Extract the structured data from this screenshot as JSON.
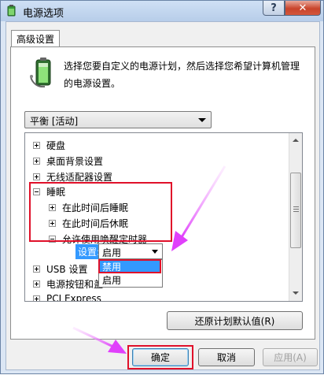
{
  "window": {
    "title": "电源选项",
    "help_label": "?",
    "close_label": "✕"
  },
  "tab": {
    "label": "高级设置"
  },
  "description": "选择您要自定义的电源计划，然后选择您希望计算机管理的电源设置。",
  "plan_select": {
    "value": "平衡 [活动]"
  },
  "tree": {
    "items": [
      {
        "label": "硬盘",
        "expanded": false
      },
      {
        "label": "桌面背景设置",
        "expanded": false
      },
      {
        "label": "无线适配器设置",
        "expanded": false
      },
      {
        "label": "睡眠",
        "expanded": true
      },
      {
        "label": "在此时间后睡眠",
        "expanded": false
      },
      {
        "label": "在此时间后休眠",
        "expanded": false
      },
      {
        "label": "允许使用唤醒定时器",
        "expanded": true
      },
      {
        "label": "USB 设置",
        "expanded": false
      },
      {
        "label": "电源按钮和盖",
        "expanded": false
      },
      {
        "label": "PCI Express",
        "expanded": false
      }
    ]
  },
  "setting": {
    "label": "设置:",
    "value": "启用",
    "options": [
      "禁用",
      "启用"
    ]
  },
  "buttons": {
    "restore": "还原计划默认值(R)",
    "ok": "确定",
    "cancel": "取消",
    "apply": "应用(A)"
  },
  "colors": {
    "highlight_box": "#e0102a",
    "annotation_arrow": "#e040fb",
    "selection": "#3399ff"
  }
}
